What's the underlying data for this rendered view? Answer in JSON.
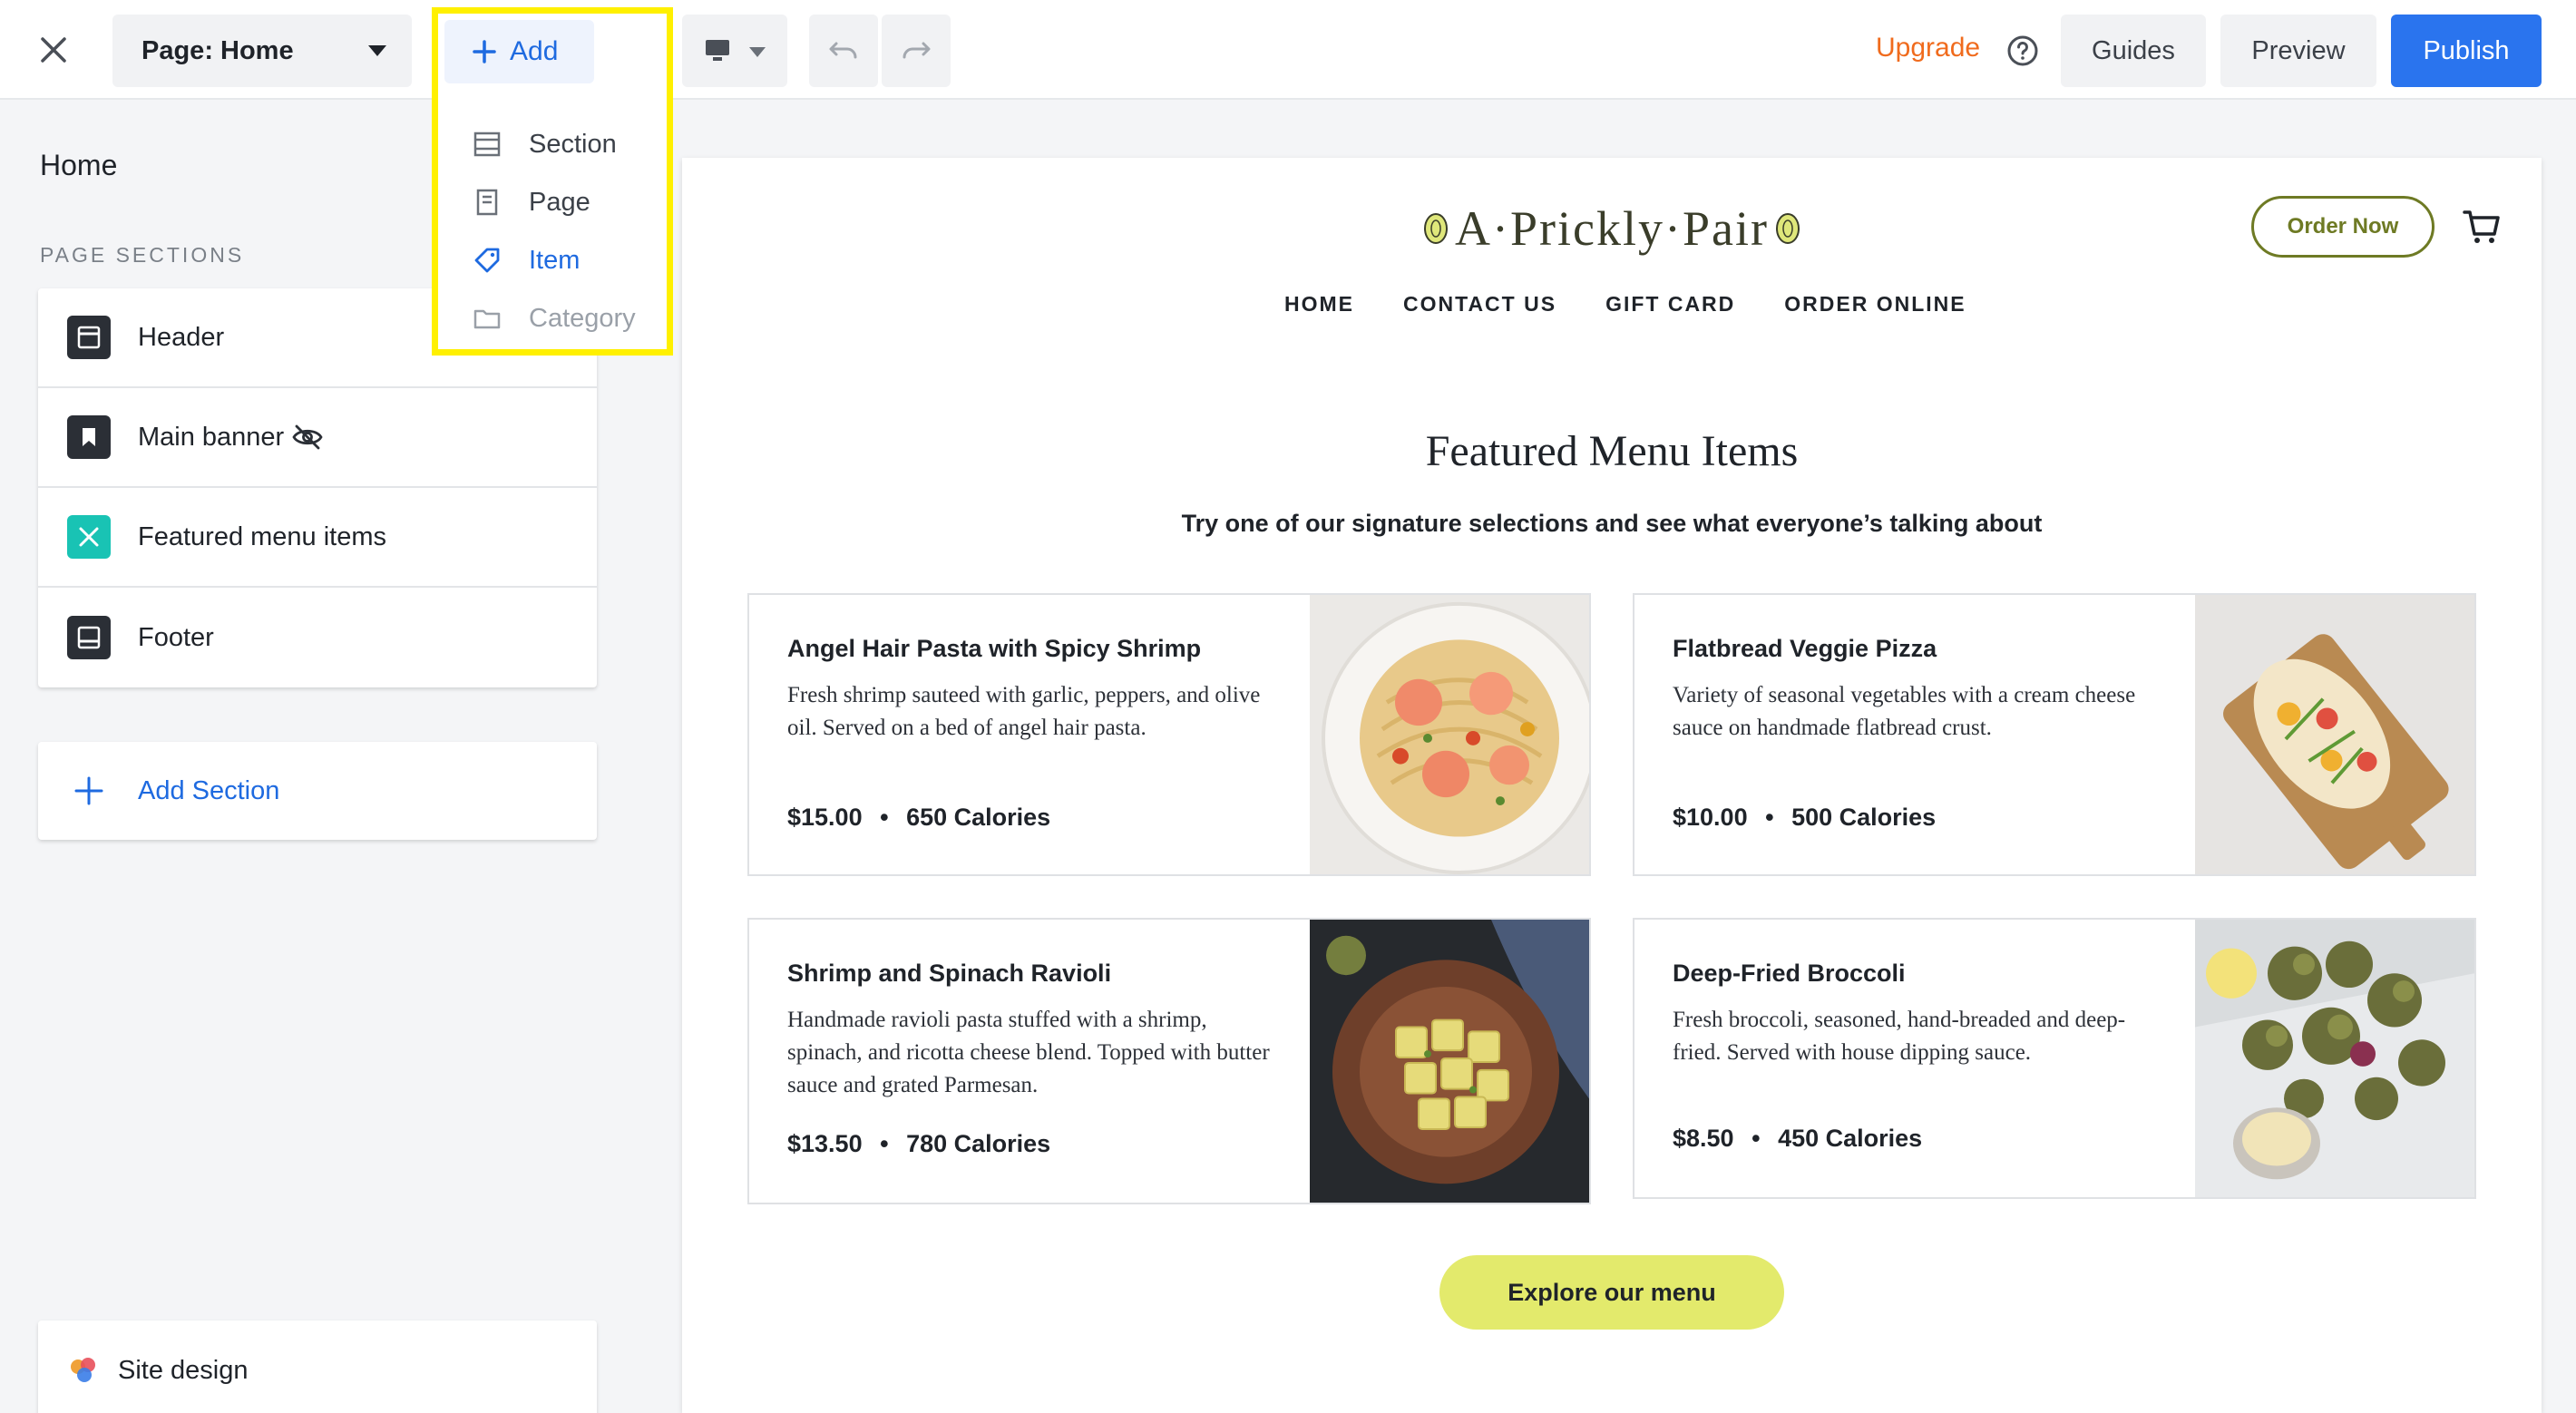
{
  "topbar": {
    "page_select_label": "Page: Home",
    "add_label": "Add",
    "upgrade_label": "Upgrade",
    "guides_label": "Guides",
    "preview_label": "Preview",
    "publish_label": "Publish"
  },
  "add_menu": {
    "items": [
      {
        "label": "Section",
        "icon": "section-icon",
        "state": "normal"
      },
      {
        "label": "Page",
        "icon": "page-icon",
        "state": "normal"
      },
      {
        "label": "Item",
        "icon": "tag-icon",
        "state": "active"
      },
      {
        "label": "Category",
        "icon": "folder-icon",
        "state": "disabled"
      }
    ]
  },
  "left_panel": {
    "title": "Home",
    "sections_heading": "PAGE SECTIONS",
    "sections": [
      {
        "label": "Header",
        "icon": "header-section-icon"
      },
      {
        "label": "Main banner",
        "icon": "banner-section-icon",
        "hidden": true
      },
      {
        "label": "Featured menu items",
        "icon": "featured-items-icon"
      },
      {
        "label": "Footer",
        "icon": "footer-section-icon"
      }
    ],
    "add_section_label": "Add Section",
    "site_design_label": "Site design"
  },
  "site": {
    "logo_text": "A·Prickly·Pair",
    "order_now_label": "Order Now",
    "nav": [
      "HOME",
      "CONTACT US",
      "GIFT CARD",
      "ORDER ONLINE"
    ],
    "featured_title": "Featured Menu Items",
    "featured_subtitle": "Try one of our signature selections and see what everyone’s talking about",
    "menu_items": [
      {
        "name": "Angel Hair Pasta with Spicy Shrimp",
        "description": "Fresh shrimp sauteed with garlic, peppers, and olive oil. Served on a bed of angel hair pasta.",
        "price": "$15.00",
        "calories": "650 Calories"
      },
      {
        "name": "Flatbread Veggie Pizza",
        "description": "Variety of seasonal vegetables with a cream cheese sauce on handmade flatbread crust.",
        "price": "$10.00",
        "calories": "500 Calories"
      },
      {
        "name": "Shrimp and Spinach Ravioli",
        "description": "Handmade ravioli pasta stuffed with a shrimp, spinach, and ricotta cheese blend. Topped with butter sauce and grated Parmesan.",
        "price": "$13.50",
        "calories": "780 Calories"
      },
      {
        "name": "Deep-Fried Broccoli",
        "description": "Fresh broccoli, seasoned, hand-breaded and deep-fried. Served with house dipping sauce.",
        "price": "$8.50",
        "calories": "450 Calories"
      }
    ],
    "explore_label": "Explore our menu",
    "separator": "•"
  },
  "colors": {
    "accent_blue": "#2a74ee",
    "upgrade_orange": "#f06b1d",
    "highlight_yellow": "#fff000",
    "brand_olive": "#6e7a24",
    "explore_button": "#e3ea6c"
  }
}
